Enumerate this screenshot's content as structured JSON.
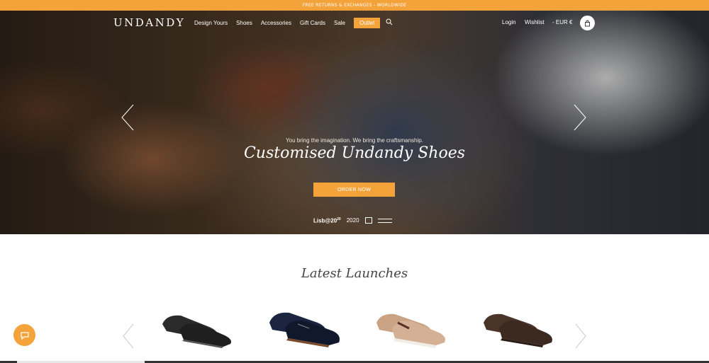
{
  "promo": {
    "text": "FREE RETURNS & EXCHANGES - WORLDWIDE"
  },
  "header": {
    "logo": "UNDANDY",
    "nav": [
      {
        "label": "Design Yours"
      },
      {
        "label": "Shoes"
      },
      {
        "label": "Accessories"
      },
      {
        "label": "Gift Cards"
      },
      {
        "label": "Sale"
      },
      {
        "label": "Outlet",
        "highlight": true
      }
    ],
    "login": "Login",
    "wishlist": "Wishlist",
    "currency": "- EUR €",
    "icons": [
      "search-icon",
      "bag-icon"
    ]
  },
  "hero": {
    "tagline": "You bring the imagination. We bring the craftsmanship.",
    "title": "Customised Undandy Shoes",
    "cta": "ORDER NOW",
    "partner_logos": {
      "lisboa": "Lisb@20",
      "lisboa_sup": "20",
      "ffl": "2020"
    }
  },
  "latest": {
    "title": "Latest Launches",
    "products": [
      {
        "icon": "loafer-shoe-image"
      },
      {
        "icon": "oxford-shoe-image"
      },
      {
        "icon": "monk-sneaker-image"
      },
      {
        "icon": "brogue-shoe-image"
      }
    ]
  },
  "colors": {
    "accent": "#f3a33a",
    "dark": "#333333"
  }
}
